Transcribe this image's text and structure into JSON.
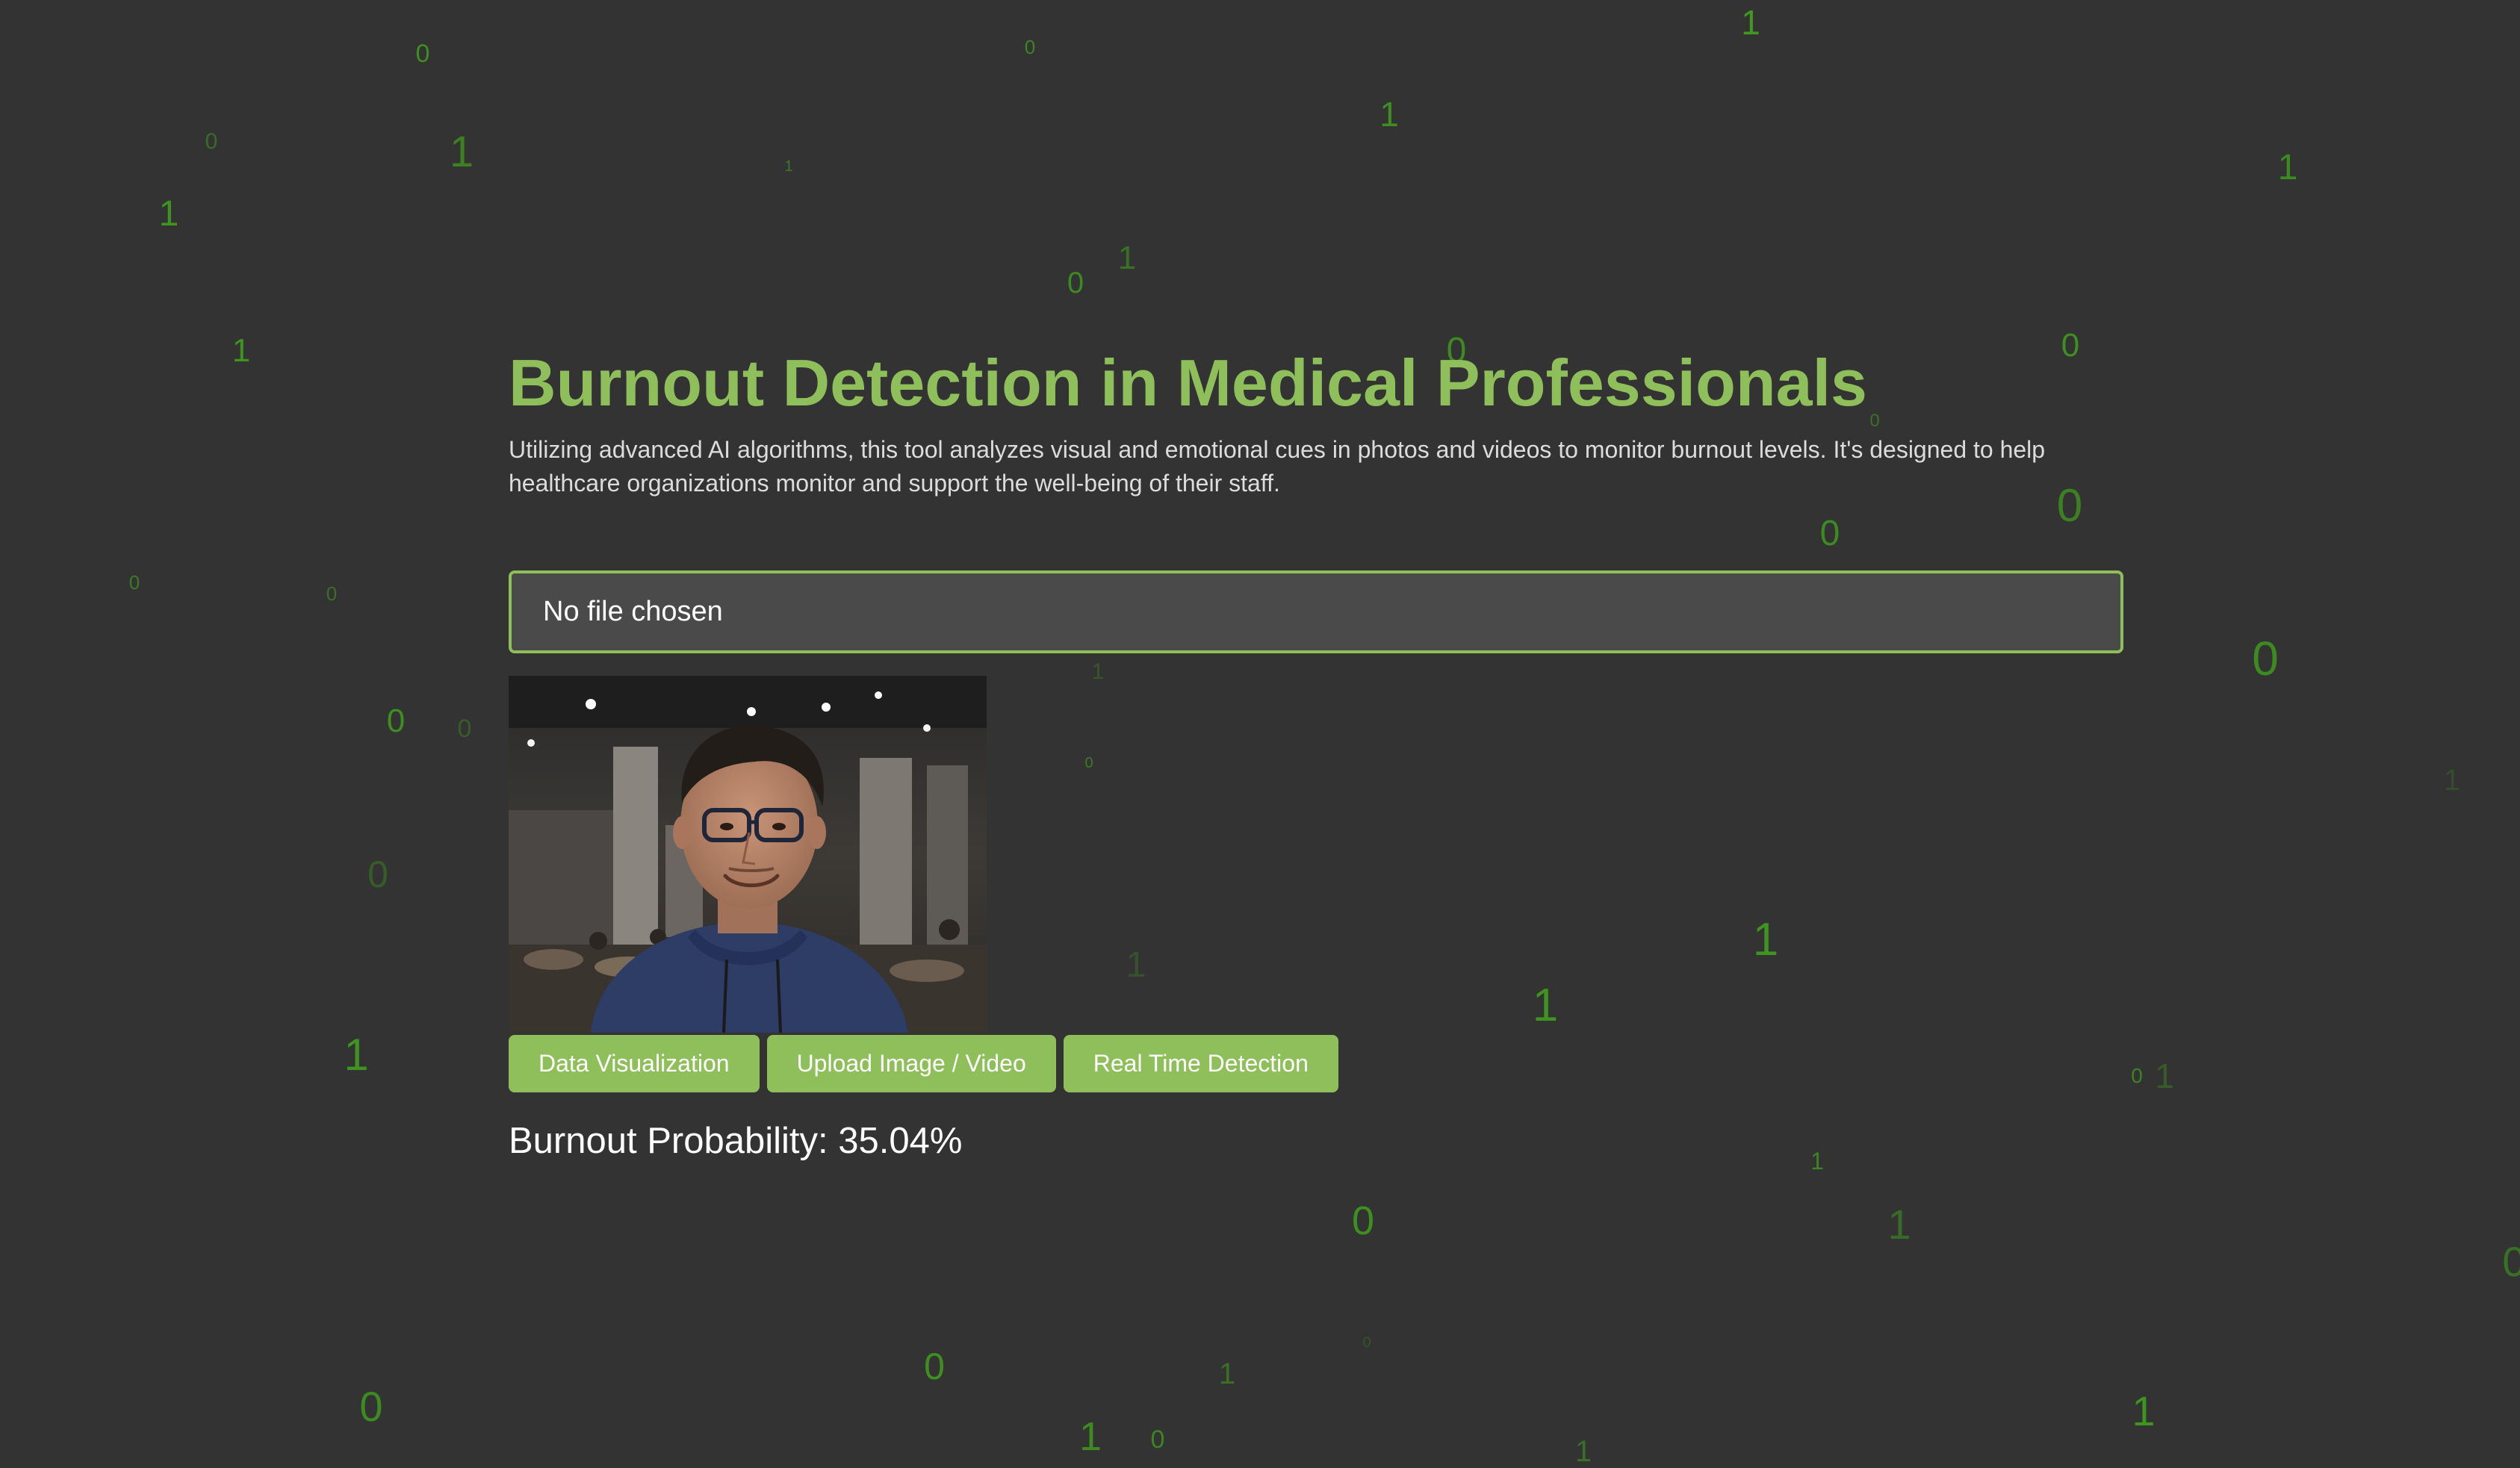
{
  "theme": {
    "background": "#333333",
    "accent": "#8fbf5a",
    "digit_color": "#3f9a1e"
  },
  "header": {
    "title": "Burnout Detection in Medical Professionals",
    "description": "Utilizing advanced AI algorithms, this tool analyzes visual and emotional cues in photos and videos to monitor burnout levels. It's designed to help healthcare organizations monitor and support the well-being of their staff."
  },
  "upload": {
    "file_label": "No file chosen"
  },
  "preview": {
    "subject": "person-photo"
  },
  "buttons": {
    "data_visualization": "Data Visualization",
    "upload_image_video": "Upload Image / Video",
    "real_time_detection": "Real Time Detection"
  },
  "result": {
    "label": "Burnout Probability: 35.04%"
  }
}
